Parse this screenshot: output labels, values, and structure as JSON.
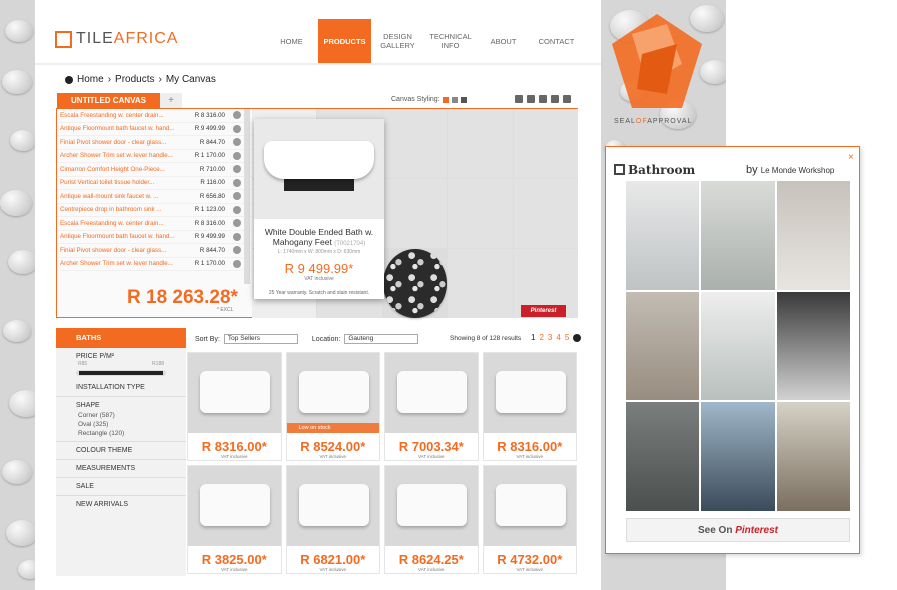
{
  "header": {
    "logo_text_a": "TILE",
    "logo_text_b": "AFRICA",
    "nav": [
      {
        "label": "HOME"
      },
      {
        "label": "PRODUCTS"
      },
      {
        "label": "DESIGN GALLERY"
      },
      {
        "label": "TECHNICAL INFO"
      },
      {
        "label": "ABOUT"
      },
      {
        "label": "CONTACT"
      }
    ],
    "active_nav": "PRODUCTS"
  },
  "breadcrumb": [
    "Home",
    "Products",
    "My Canvas"
  ],
  "canvas": {
    "tab_label": "UNTITLED CANVAS",
    "add_tab": "+",
    "styling_label": "Canvas Styling:",
    "items": [
      {
        "name": "Escala Freestanding w. center drain...",
        "price": "R 8 316.00"
      },
      {
        "name": "Antique Floormount bath faucet w. hand...",
        "price": "R 9 499.99"
      },
      {
        "name": "Finial Pivot shower door - clear glass...",
        "price": "R 844.70"
      },
      {
        "name": "Archer Shower Trim set w. lever handle...",
        "price": "R 1 170.00"
      },
      {
        "name": "Cimarron Comfort Height One-Piece...",
        "price": "R 710.00"
      },
      {
        "name": "Purist Vertical toilet tissue holder...",
        "price": "R 116.00"
      },
      {
        "name": "Antique wall-mount sink faucet w. ...",
        "price": "R 656.80"
      },
      {
        "name": "Centrepiece drop in bathroom sink ...",
        "price": "R 1 123.00"
      },
      {
        "name": "Escala Freestanding w. center drain...",
        "price": "R 8 316.00"
      },
      {
        "name": "Antique Floormount bath faucet w. hand...",
        "price": "R 9 499.99"
      },
      {
        "name": "Finial Pivot shower door - clear glass...",
        "price": "R 844.70"
      },
      {
        "name": "Archer Shower Trim set w. lever handle...",
        "price": "R 1 170.00"
      }
    ],
    "total": "R 18 263.28*",
    "total_note": "* EXCL",
    "popup": {
      "title": "White Double Ended Bath w. Mahogany Feet",
      "code": "(T0021704)",
      "dims": "L: 1740mm x W: 800mm x D: 630mm",
      "price": "R 9 499.99*",
      "vat": "VAT inclusive",
      "warranty": "25 Year warranty. Scratch and stain resistant."
    },
    "pinterest_label": "Pinterest"
  },
  "filters": {
    "category": "BATHS",
    "price_label": "PRICE P/M²",
    "price_min": "R85",
    "price_max": "R188",
    "installation": "INSTALLATION TYPE",
    "shape": "SHAPE",
    "shape_options": [
      "Corner (587)",
      "Oval (325)",
      "Rectangle (120)"
    ],
    "colour": "COLOUR THEME",
    "measurements": "MEASUREMENTS",
    "sale": "SALE",
    "new": "NEW ARRIVALS"
  },
  "toolbar": {
    "sort_label": "Sort By:",
    "sort_value": "Top Sellers",
    "location_label": "Location:",
    "location_value": "Gauteng",
    "showing": "Showing 8 of 128 results",
    "pages": [
      "1",
      "2",
      "3",
      "4",
      "5"
    ]
  },
  "products": [
    {
      "price": "R 8316.00*",
      "vat": "VAT inclusive"
    },
    {
      "price": "R 8524.00*",
      "vat": "VAT inclusive",
      "stock": "Low on stock"
    },
    {
      "price": "R 7003.34*",
      "vat": "VAT inclusive"
    },
    {
      "price": "R 8316.00*",
      "vat": "VAT inclusive"
    },
    {
      "price": "R 3825.00*",
      "vat": "VAT inclusive"
    },
    {
      "price": "R 6821.00*",
      "vat": "VAT inclusive"
    },
    {
      "price": "R 8624.25*",
      "vat": "VAT inclusive"
    },
    {
      "price": "R 4732.00*",
      "vat": "VAT inclusive"
    }
  ],
  "seal": {
    "text_a": "SEAL",
    "text_b": "OF",
    "text_c": "APPROVAL"
  },
  "widget": {
    "close": "×",
    "title": "Bathroom",
    "by": "by",
    "author": "Le Monde Workshop",
    "button_a": "See On",
    "button_b": "Pinterest"
  },
  "colors": {
    "accent": "#f26b21",
    "pinterest": "#cb2027"
  }
}
